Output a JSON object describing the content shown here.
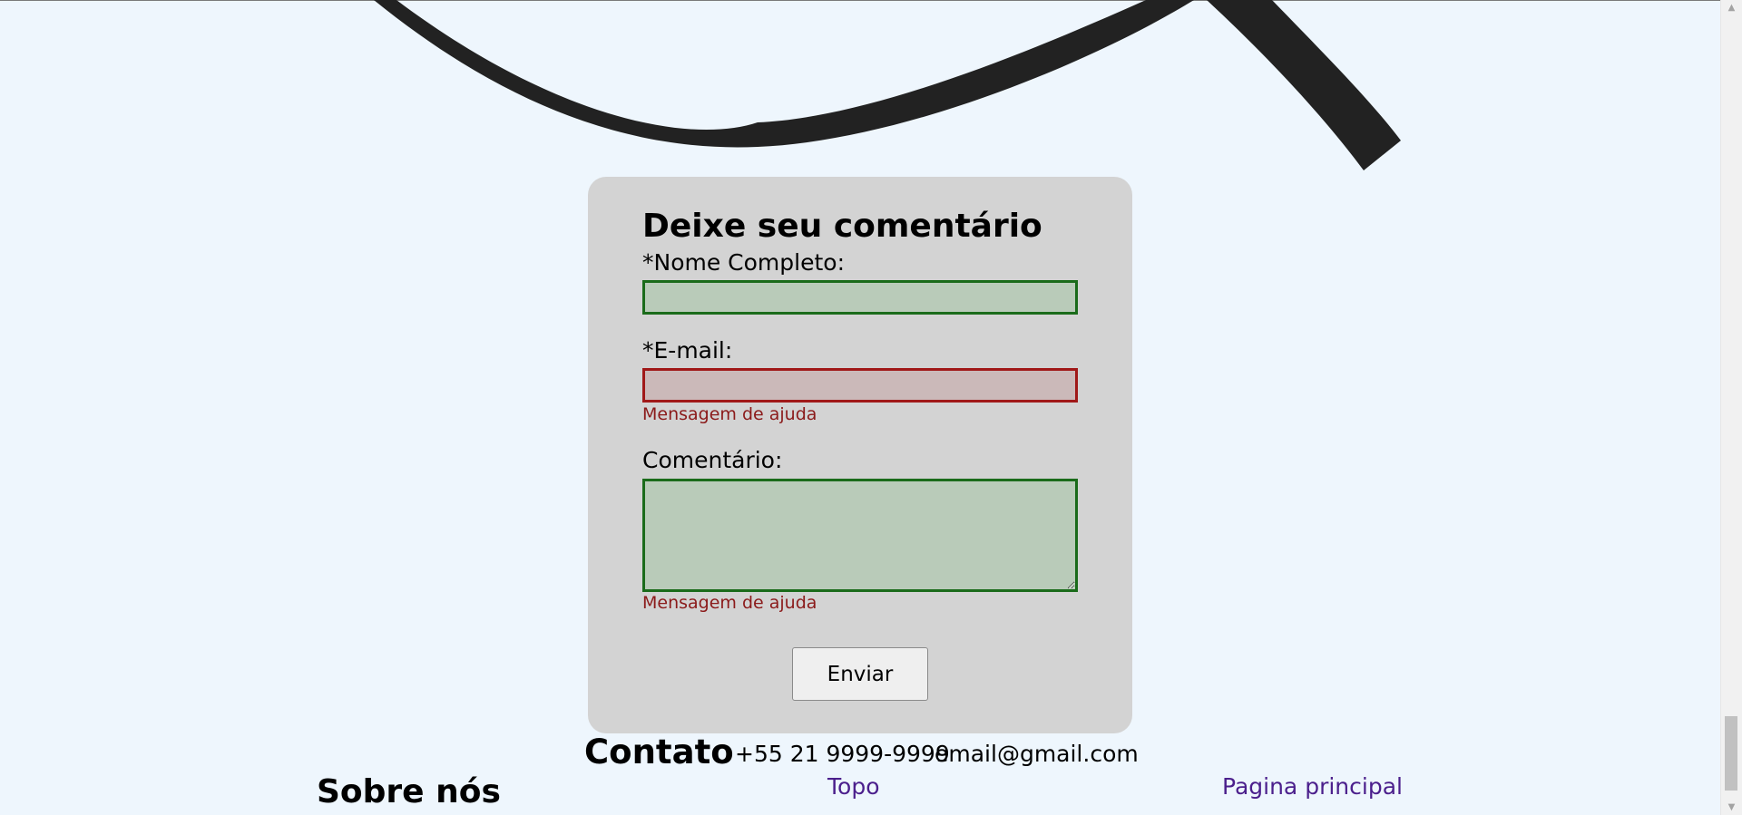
{
  "form": {
    "title": "Deixe seu comentário",
    "name_label": "*Nome Completo:",
    "name_value": "",
    "email_label": "*E-mail:",
    "email_value": "",
    "email_help": "Mensagem de ajuda",
    "comment_label": "Comentário:",
    "comment_value": "",
    "comment_help": "Mensagem de ajuda",
    "submit_label": "Enviar"
  },
  "footer": {
    "contact_title": "Contato",
    "phone": "+55 21 9999-9999",
    "email": "email@gmail.com",
    "about_title": "Sobre nós",
    "top_link": "Topo",
    "home_link": "Pagina principal"
  },
  "icons": {
    "scroll_up": "scroll-up-arrow-icon",
    "scroll_down": "scroll-down-arrow-icon",
    "textarea_resize": "resize-grip-icon"
  },
  "colors": {
    "page_background": "#eef6fd",
    "card_background": "#d3d3d3",
    "valid_border": "#1a6b1a",
    "valid_fill": "#b9cbb9",
    "error_border": "#a01818",
    "error_fill": "#cbb9b9",
    "help_text": "#8b1a1a",
    "link": "#4b1f8c"
  }
}
